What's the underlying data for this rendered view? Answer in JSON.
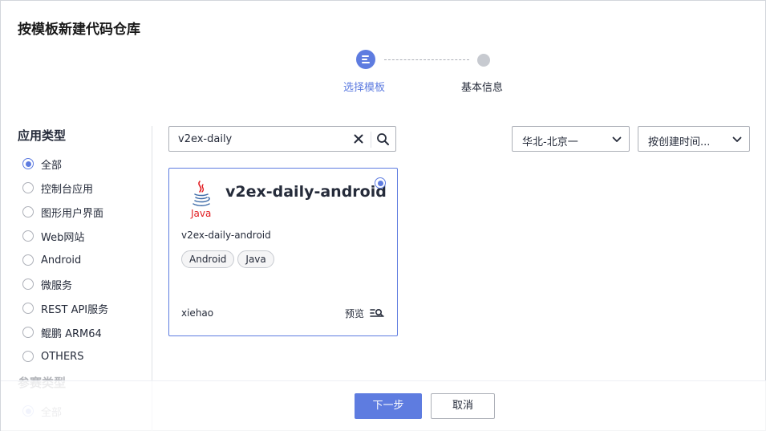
{
  "dialog": {
    "title": "按模板新建代码仓库"
  },
  "steps": [
    {
      "label": "选择模板",
      "state": "active"
    },
    {
      "label": "基本信息",
      "state": "pending"
    }
  ],
  "filters": {
    "app_type": {
      "title": "应用类型",
      "options": [
        {
          "label": "全部",
          "checked": true
        },
        {
          "label": "控制台应用",
          "checked": false
        },
        {
          "label": "图形用户界面",
          "checked": false
        },
        {
          "label": "Web网站",
          "checked": false
        },
        {
          "label": "Android",
          "checked": false
        },
        {
          "label": "微服务",
          "checked": false
        },
        {
          "label": "REST API服务",
          "checked": false
        },
        {
          "label": "鲲鹏 ARM64",
          "checked": false
        },
        {
          "label": "OTHERS",
          "checked": false
        }
      ]
    },
    "contest_type": {
      "title": "参赛类型",
      "options": [
        {
          "label": "全部",
          "checked": true
        }
      ]
    }
  },
  "search": {
    "value": "v2ex-daily",
    "clear_icon": "close-icon",
    "search_icon": "search-icon"
  },
  "region_select": {
    "value": "华北-北京一"
  },
  "sort_select": {
    "value": "按创建时间..."
  },
  "templates": [
    {
      "name": "v2ex-daily-android",
      "logo": "java-logo-icon",
      "logo_text": "Java",
      "description": "v2ex-daily-android",
      "tags": [
        "Android",
        "Java"
      ],
      "author": "xiehao",
      "preview_label": "预览",
      "selected": true
    }
  ],
  "footer": {
    "next_label": "下一步",
    "cancel_label": "取消"
  },
  "colors": {
    "accent": "#5e7ce0",
    "border": "#adb0b8",
    "text": "#252b3a",
    "java_red": "#e11e22"
  }
}
